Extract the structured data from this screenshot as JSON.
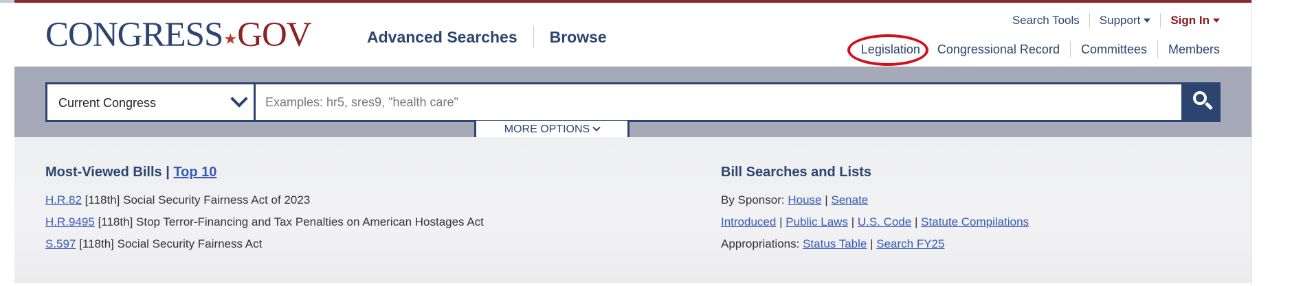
{
  "logo": {
    "part1": "CONGRESS",
    "dot": "★",
    "part2": "GOV"
  },
  "main_nav": {
    "advanced": "Advanced Searches",
    "browse": "Browse"
  },
  "util_nav": {
    "search_tools": "Search Tools",
    "support": "Support",
    "sign_in": "Sign In"
  },
  "section_nav": {
    "legislation": "Legislation",
    "congressional_record": "Congressional Record",
    "committees": "Committees",
    "members": "Members"
  },
  "search": {
    "scope_value": "Current Congress",
    "placeholder": "Examples: hr5, sres9, \"health care\"",
    "more_options": "MORE OPTIONS"
  },
  "most_viewed": {
    "heading": "Most-Viewed Bills |",
    "top10": "Top 10",
    "bills": [
      {
        "id": "H.R.82",
        "congress": "[118th]",
        "title": "Social Security Fairness Act of 2023"
      },
      {
        "id": "H.R.9495",
        "congress": "[118th]",
        "title": "Stop Terror-Financing and Tax Penalties on American Hostages Act"
      },
      {
        "id": "S.597",
        "congress": "[118th]",
        "title": "Social Security Fairness Act"
      }
    ]
  },
  "bill_searches": {
    "heading": "Bill Searches and Lists",
    "by_sponsor_label": "By Sponsor:",
    "house": "House",
    "senate": "Senate",
    "introduced": "Introduced",
    "public_laws": "Public Laws",
    "us_code": "U.S. Code",
    "statute": "Statute Compilations",
    "appropriations_label": "Appropriations:",
    "status_table": "Status Table",
    "search_fy25": "Search FY25",
    "pipe": "|"
  },
  "colors": {
    "navy": "#2b4470",
    "brand_red": "#8b2323",
    "link": "#3559b4",
    "highlight": "#d0101a"
  }
}
